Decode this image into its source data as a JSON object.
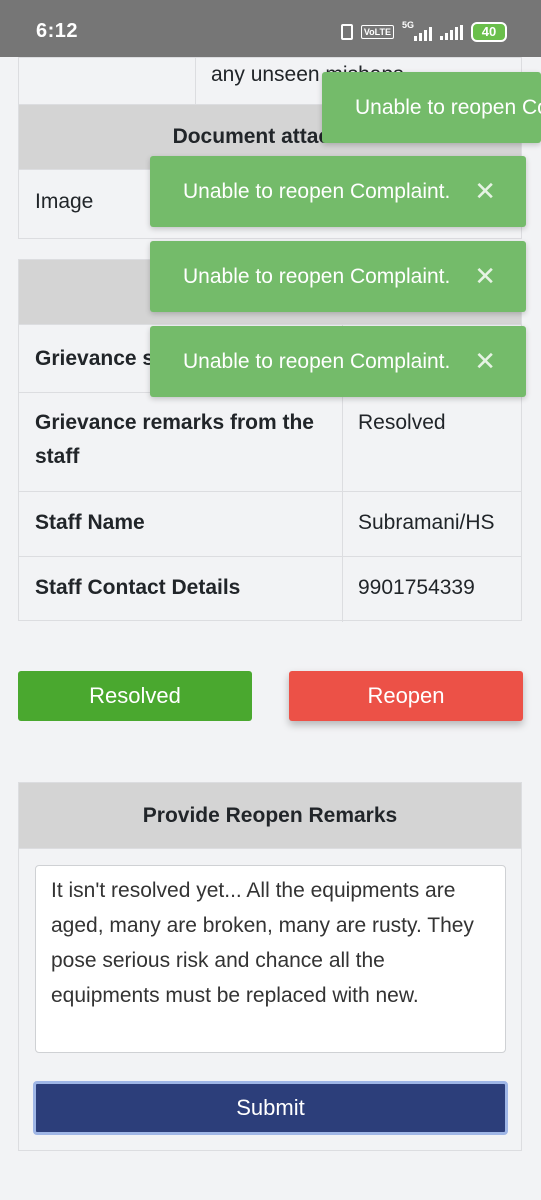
{
  "status_bar": {
    "time": "6:12",
    "volte": "VoLTE",
    "network": "5G",
    "battery": "40"
  },
  "top_table": {
    "partial_text": "any unseen mishaps",
    "doc_header": "Document attached",
    "image_label": "Image"
  },
  "staff_table": {
    "rows": [
      {
        "label": "Grievance status",
        "value": ""
      },
      {
        "label": "Grievance remarks from the staff",
        "value": "Resolved"
      },
      {
        "label": "Staff Name",
        "value": "Subramani/HS"
      },
      {
        "label": "Staff Contact Details",
        "value": "9901754339"
      }
    ]
  },
  "actions": {
    "resolved_label": "Resolved",
    "reopen_label": "Reopen"
  },
  "reopen_form": {
    "header": "Provide Reopen Remarks",
    "remarks": "It isn't resolved yet... All the equipments are aged, many are broken, many are rusty. They pose serious risk and chance all the equipments must be replaced with new.",
    "submit_label": "Submit"
  },
  "toasts": [
    {
      "message": "Unable to reopen Complaint.",
      "close": "✕"
    },
    {
      "message": "Unable to reopen Complaint.",
      "close": "✕"
    },
    {
      "message": "Unable to reopen Complaint.",
      "close": "✕"
    },
    {
      "message": "Unable to reopen Complaint.",
      "close": "✕"
    }
  ],
  "colors": {
    "toast_bg": "#74bb6a",
    "resolved_bg": "#4aa82f",
    "reopen_bg": "#ec5147",
    "submit_bg": "#2c3e7a"
  }
}
